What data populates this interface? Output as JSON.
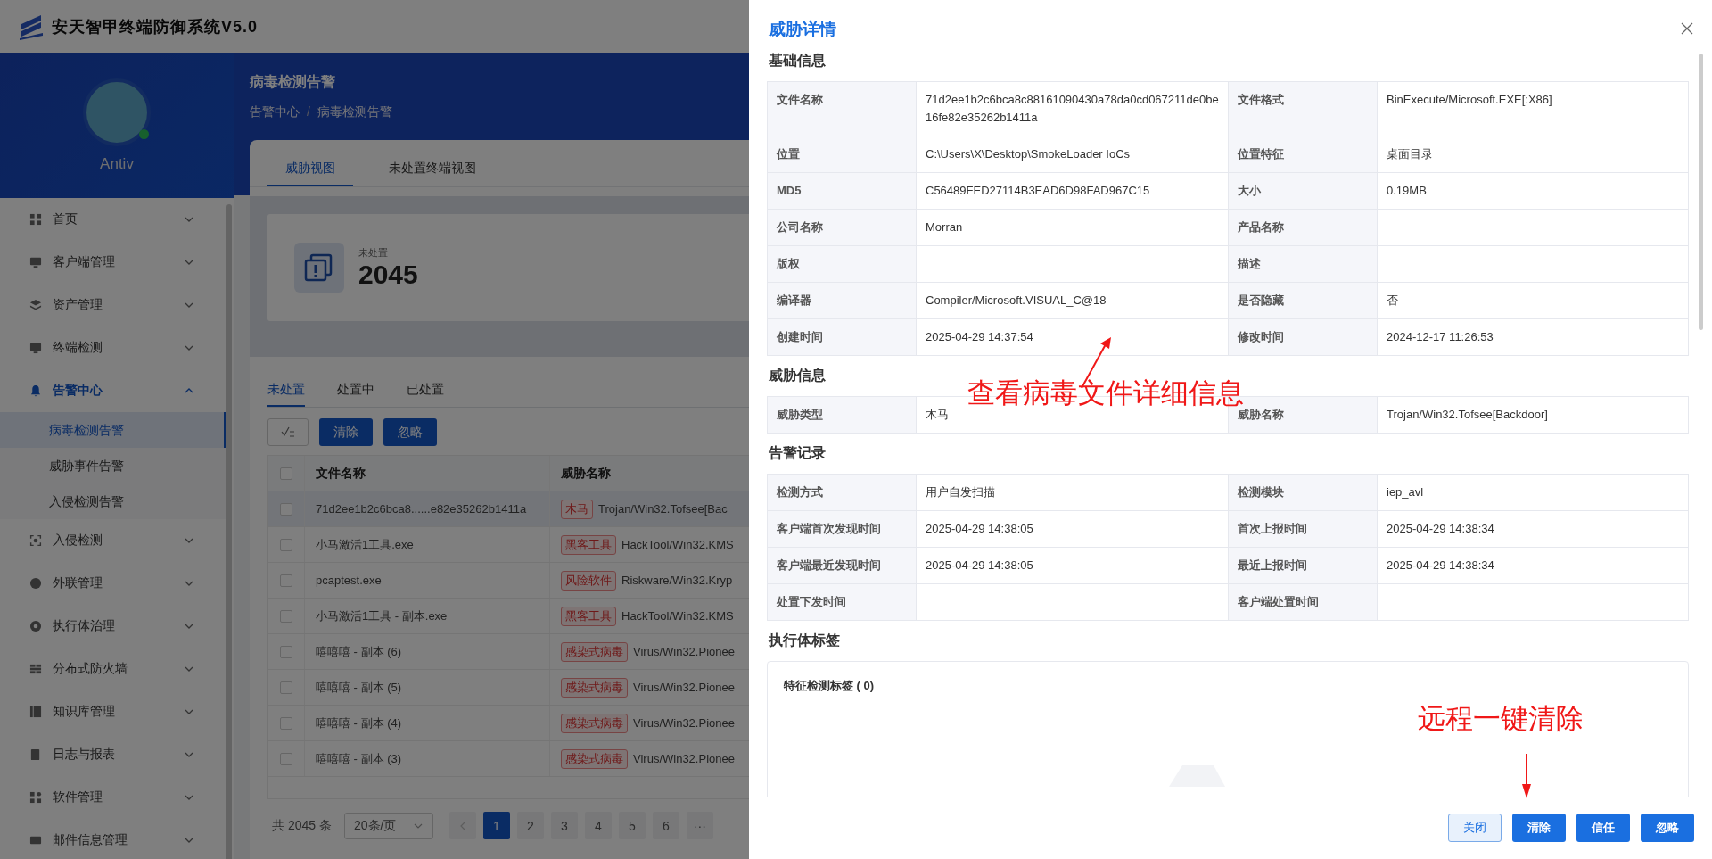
{
  "app": {
    "title": "安天智甲终端防御系统V5.0",
    "user": "Antiv"
  },
  "sidebar": {
    "items": [
      {
        "label": "首页",
        "expanded": false
      },
      {
        "label": "客户端管理",
        "expanded": false
      },
      {
        "label": "资产管理",
        "expanded": false
      },
      {
        "label": "终端检测",
        "expanded": false
      },
      {
        "label": "告警中心",
        "expanded": true,
        "children": [
          {
            "label": "病毒检测告警",
            "selected": true
          },
          {
            "label": "威胁事件告警",
            "selected": false
          },
          {
            "label": "入侵检测告警",
            "selected": false
          }
        ]
      },
      {
        "label": "入侵检测",
        "expanded": false
      },
      {
        "label": "外联管理",
        "expanded": false
      },
      {
        "label": "执行体治理",
        "expanded": false
      },
      {
        "label": "分布式防火墙",
        "expanded": false
      },
      {
        "label": "知识库管理",
        "expanded": false
      },
      {
        "label": "日志与报表",
        "expanded": false
      },
      {
        "label": "软件管理",
        "expanded": false
      },
      {
        "label": "邮件信息管理",
        "expanded": false
      }
    ]
  },
  "page": {
    "title": "病毒检测告警",
    "breadcrumb": [
      "告警中心",
      "病毒检测告警"
    ],
    "breadcrumb_separator": "/"
  },
  "view_tabs": [
    {
      "label": "威胁视图",
      "selected": true
    },
    {
      "label": "未处置终端视图",
      "selected": false
    }
  ],
  "stat": {
    "label": "未处置",
    "value": "2045"
  },
  "status_tabs": [
    {
      "label": "未处置",
      "selected": true
    },
    {
      "label": "处置中",
      "selected": false
    },
    {
      "label": "已处置",
      "selected": false
    }
  ],
  "toolbar": {
    "buttons": [
      "清除",
      "忽略"
    ]
  },
  "table": {
    "all_checked": false,
    "columns": [
      "文件名称",
      "威胁名称"
    ],
    "rows": [
      {
        "file": "71d2ee1b2c6bca8......e82e35262b1411a",
        "tag": "木马",
        "threat": "Trojan/Win32.Tofsee[Bac",
        "checked": false,
        "selected": true
      },
      {
        "file": "小马激活1工具.exe",
        "tag": "黑客工具",
        "threat": "HackTool/Win32.KMS",
        "checked": false,
        "selected": false
      },
      {
        "file": "pcaptest.exe",
        "tag": "风险软件",
        "threat": "Riskware/Win32.Kryp",
        "checked": false,
        "selected": false
      },
      {
        "file": "小马激活1工具 - 副本.exe",
        "tag": "黑客工具",
        "threat": "HackTool/Win32.KMS",
        "checked": false,
        "selected": false
      },
      {
        "file": "嘻嘻嘻 - 副本 (6)",
        "tag": "感染式病毒",
        "threat": "Virus/Win32.Pionee",
        "checked": false,
        "selected": false
      },
      {
        "file": "嘻嘻嘻 - 副本 (5)",
        "tag": "感染式病毒",
        "threat": "Virus/Win32.Pionee",
        "checked": false,
        "selected": false
      },
      {
        "file": "嘻嘻嘻 - 副本 (4)",
        "tag": "感染式病毒",
        "threat": "Virus/Win32.Pionee",
        "checked": false,
        "selected": false
      },
      {
        "file": "嘻嘻嘻 - 副本 (3)",
        "tag": "感染式病毒",
        "threat": "Virus/Win32.Pionee",
        "checked": false,
        "selected": false
      }
    ]
  },
  "pagination": {
    "total": "共 2045 条",
    "page_size": "20条/页",
    "pages": [
      {
        "label": "1",
        "selected": true
      },
      {
        "label": "2",
        "selected": false
      },
      {
        "label": "3",
        "selected": false
      },
      {
        "label": "4",
        "selected": false
      },
      {
        "label": "5",
        "selected": false
      },
      {
        "label": "6",
        "selected": false
      }
    ],
    "more": "···"
  },
  "drawer": {
    "title": "威胁详情",
    "sections": [
      {
        "title": "基础信息",
        "fields": [
          {
            "label": "文件名称",
            "value": "71d2ee1b2c6bca8c88161090430a78da0cd067211de0be16fe82e35262b1411a"
          },
          {
            "label": "文件格式",
            "value": "BinExecute/Microsoft.EXE[:X86]"
          },
          {
            "label": "位置",
            "value": "C:\\Users\\X\\Desktop\\SmokeLoader IoCs"
          },
          {
            "label": "位置特征",
            "value": "桌面目录"
          },
          {
            "label": "MD5",
            "value": "C56489FED27114B3EAD6D98FAD967C15"
          },
          {
            "label": "大小",
            "value": "0.19MB"
          },
          {
            "label": "公司名称",
            "value": "Morran"
          },
          {
            "label": "产品名称"
          },
          {
            "label": "版权"
          },
          {
            "label": "描述"
          },
          {
            "label": "编译器",
            "value": "Compiler/Microsoft.VISUAL_C@18"
          },
          {
            "label": "是否隐藏",
            "value": "否"
          },
          {
            "label": "创建时间",
            "value": "2025-04-29 14:37:54"
          },
          {
            "label": "修改时间",
            "value": "2024-12-17 11:26:53"
          }
        ]
      },
      {
        "title": "威胁信息",
        "fields": [
          {
            "label": "威胁类型",
            "value": "木马"
          },
          {
            "label": "威胁名称",
            "value": "Trojan/Win32.Tofsee[Backdoor]"
          }
        ]
      },
      {
        "title": "告警记录",
        "fields": [
          {
            "label": "检测方式",
            "value": "用户自发扫描"
          },
          {
            "label": "检测模块",
            "value": "iep_avl"
          },
          {
            "label": "客户端首次发现时间",
            "value": "2025-04-29 14:38:05"
          },
          {
            "label": "首次上报时间",
            "value": "2025-04-29 14:38:34"
          },
          {
            "label": "客户端最近发现时间",
            "value": "2025-04-29 14:38:05"
          },
          {
            "label": "最近上报时间",
            "value": "2025-04-29 14:38:34"
          },
          {
            "label": "处置下发时间"
          },
          {
            "label": "客户端处置时间"
          }
        ]
      }
    ],
    "tag_section": {
      "title": "执行体标签",
      "panel_title": "特征检测标签 ( 0)"
    },
    "buttons": [
      {
        "label": "关闭",
        "kind": "plain"
      },
      {
        "label": "清除",
        "kind": "primary"
      },
      {
        "label": "信任",
        "kind": "primary"
      },
      {
        "label": "忽略",
        "kind": "primary"
      }
    ]
  },
  "annotations": [
    {
      "text": "查看病毒文件详细信息"
    },
    {
      "text": "远程一键清除"
    }
  ]
}
